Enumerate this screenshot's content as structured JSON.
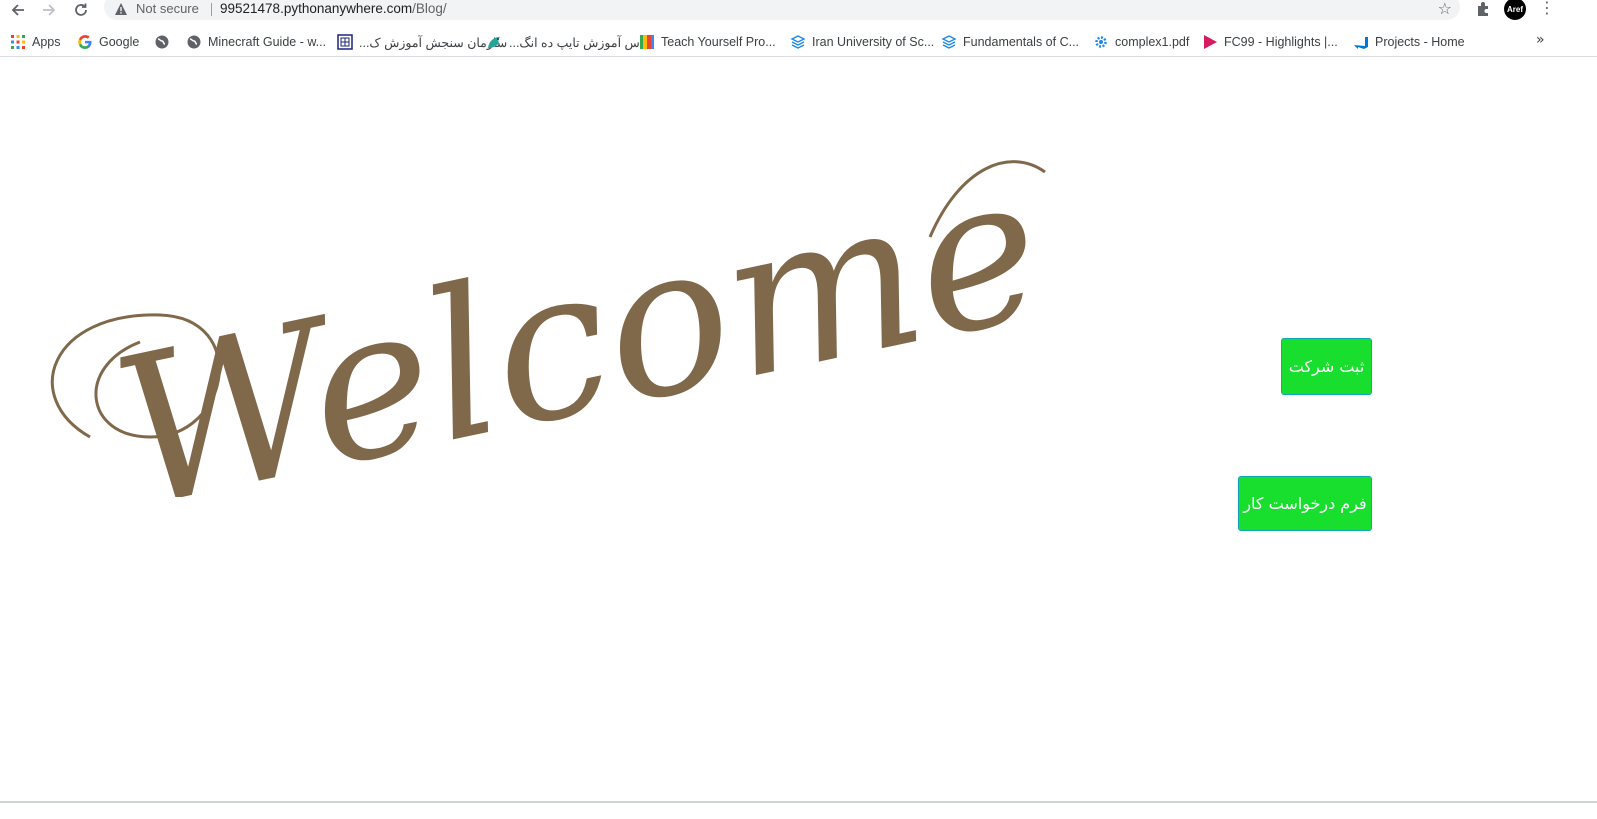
{
  "browser": {
    "omnibox": {
      "security_label": "Not secure",
      "url_host": "99521478.pythonanywhere.com",
      "url_path": "/Blog/"
    },
    "profile_label": "Aref",
    "bookmarks": [
      {
        "label": "Apps",
        "icon": "apps-grid-icon"
      },
      {
        "label": "Google",
        "icon": "google-icon"
      },
      {
        "label": "",
        "icon": "globe-icon"
      },
      {
        "label": "Minecraft Guide - w...",
        "icon": "globe-icon"
      },
      {
        "label": "سازمان سنجش آموزش ک...",
        "icon": "sanjesh-icon"
      },
      {
        "label": "کلاس آموزش تایپ ده انگ...",
        "icon": "bird-icon"
      },
      {
        "label": "Teach Yourself Pro...",
        "icon": "colorful-n-icon"
      },
      {
        "label": "Iran University of Sc...",
        "icon": "layers-icon"
      },
      {
        "label": "Fundamentals of C...",
        "icon": "layers-icon"
      },
      {
        "label": "complex1.pdf",
        "icon": "gear-doc-icon"
      },
      {
        "label": "FC99 - Highlights |...",
        "icon": "play-icon"
      },
      {
        "label": "Projects - Home",
        "icon": "azure-devops-icon"
      }
    ],
    "more_label": "»"
  },
  "page": {
    "welcome_text": "Welcome",
    "buttons": {
      "register_company": "ثبت شرکت",
      "job_application": "فرم درخواست کار"
    },
    "colors": {
      "welcome": "#80684a",
      "button_bg": "#18de2e",
      "button_border": "#0fa6b8"
    }
  }
}
